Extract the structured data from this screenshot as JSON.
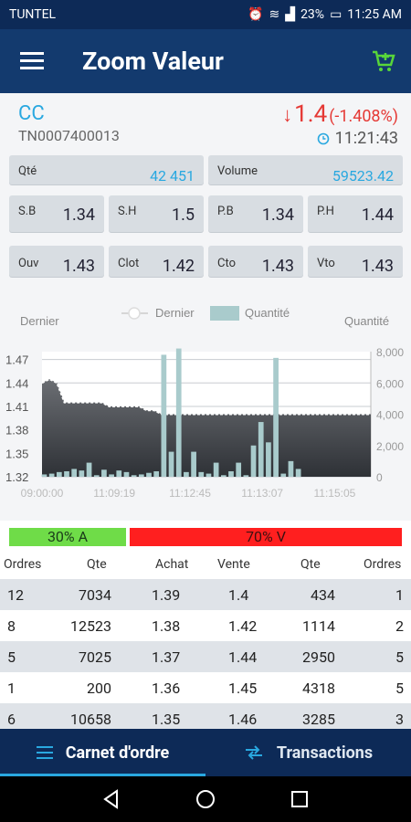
{
  "status": {
    "carrier": "TUNTEL",
    "battery": "23%",
    "clock": "11:25 AM"
  },
  "app": {
    "title": "Zoom Valeur"
  },
  "stock": {
    "ticker": "CC",
    "isin": "TN0007400013",
    "price": "1.4",
    "change": "(-1.408%)",
    "time": "11:21:43"
  },
  "cards": {
    "qte": {
      "label": "Qté",
      "value": "42 451"
    },
    "volume": {
      "label": "Volume",
      "value": "59523.42"
    },
    "sb": {
      "label": "S.B",
      "value": "1.34"
    },
    "sh": {
      "label": "S.H",
      "value": "1.5"
    },
    "pb": {
      "label": "P.B",
      "value": "1.34"
    },
    "ph": {
      "label": "P.H",
      "value": "1.44"
    },
    "ouv": {
      "label": "Ouv",
      "value": "1.43"
    },
    "clot": {
      "label": "Clot",
      "value": "1.42"
    },
    "cto": {
      "label": "Cto",
      "value": "1.43"
    },
    "vto": {
      "label": "Vto",
      "value": "1.43"
    }
  },
  "chart_data": {
    "type": "line",
    "left_axis_label": "Dernier",
    "right_axis_label": "Quantité",
    "legend": [
      "Dernier",
      "Quantité"
    ],
    "x_ticks": [
      "09:00:00",
      "11:09:19",
      "11:12:45",
      "11:13:07",
      "11:15:05"
    ],
    "y_left_ticks": [
      1.32,
      1.35,
      1.38,
      1.41,
      1.44,
      1.47
    ],
    "y_left_range": [
      1.32,
      1.48
    ],
    "y_right_ticks": [
      "0",
      "2,000",
      "4,000",
      "6,000",
      "8,000"
    ],
    "y_right_range": [
      0,
      8000
    ],
    "price": [
      1.44,
      1.445,
      1.44,
      1.415,
      1.415,
      1.415,
      1.415,
      1.415,
      1.415,
      1.41,
      1.41,
      1.41,
      1.41,
      1.41,
      1.405,
      1.405,
      1.4,
      1.4,
      1.4,
      1.4,
      1.4,
      1.4,
      1.4,
      1.4,
      1.4,
      1.4,
      1.4,
      1.4,
      1.4,
      1.4,
      1.4,
      1.4,
      1.4,
      1.4,
      1.4,
      1.4,
      1.4,
      1.4,
      1.4,
      1.4,
      1.4,
      1.4,
      1.4,
      1.4,
      1.4
    ],
    "quantity": [
      150,
      200,
      300,
      350,
      500,
      400,
      900,
      100,
      450,
      150,
      400,
      300,
      100,
      150,
      250,
      350,
      7800,
      1600,
      8200,
      300,
      1600,
      300,
      200,
      900,
      100,
      350,
      900,
      100,
      2000,
      3500,
      2200,
      7600,
      200,
      1000,
      500,
      0,
      0,
      0,
      0,
      0,
      0,
      0,
      0,
      0,
      0
    ]
  },
  "ratio": {
    "buy": "30% A",
    "sell": "70% V"
  },
  "orderbook": {
    "headers": [
      "Ordres",
      "Qte",
      "Achat",
      "Vente",
      "Qte",
      "Ordres"
    ],
    "rows": [
      [
        "12",
        "7034",
        "1.39",
        "1.4",
        "434",
        "1"
      ],
      [
        "8",
        "12523",
        "1.38",
        "1.42",
        "1114",
        "2"
      ],
      [
        "5",
        "7025",
        "1.37",
        "1.44",
        "2950",
        "5"
      ],
      [
        "1",
        "200",
        "1.36",
        "1.45",
        "4318",
        "5"
      ],
      [
        "6",
        "10658",
        "1.35",
        "1.46",
        "3285",
        "3"
      ]
    ]
  },
  "tabs": {
    "carnet": "Carnet d'ordre",
    "transactions": "Transactions"
  }
}
